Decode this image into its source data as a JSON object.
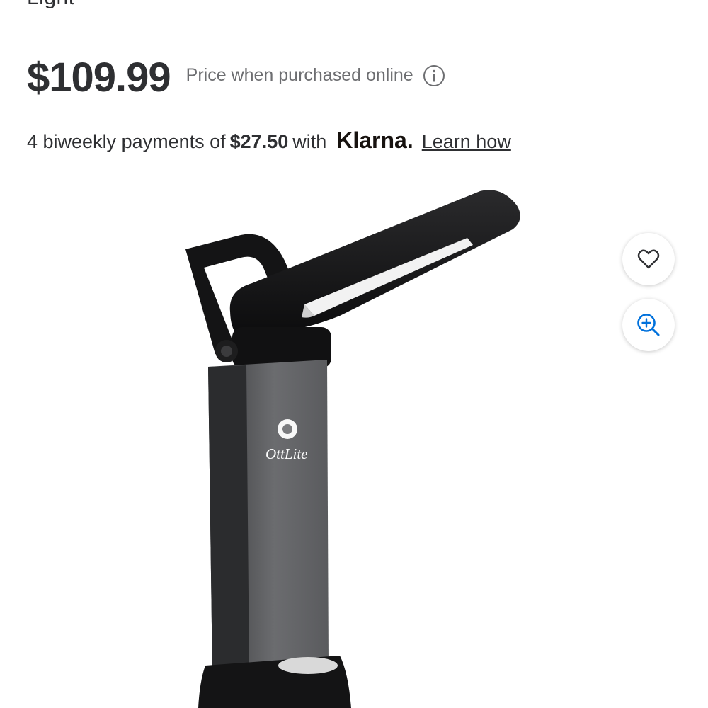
{
  "product": {
    "title_fragment": "Light",
    "price": "$109.99",
    "price_note": "Price when purchased online",
    "brand_on_image": "OttLite"
  },
  "klarna": {
    "prefix": "4 biweekly payments of",
    "amount": "$27.50",
    "with": "with",
    "logo": "Klarna.",
    "link": "Learn how"
  },
  "actions": {
    "favorite_icon": "heart-icon",
    "zoom_icon": "zoom-in-icon"
  },
  "colors": {
    "text": "#2e2f32",
    "muted": "#6d6e71",
    "accent": "#0071dc"
  }
}
